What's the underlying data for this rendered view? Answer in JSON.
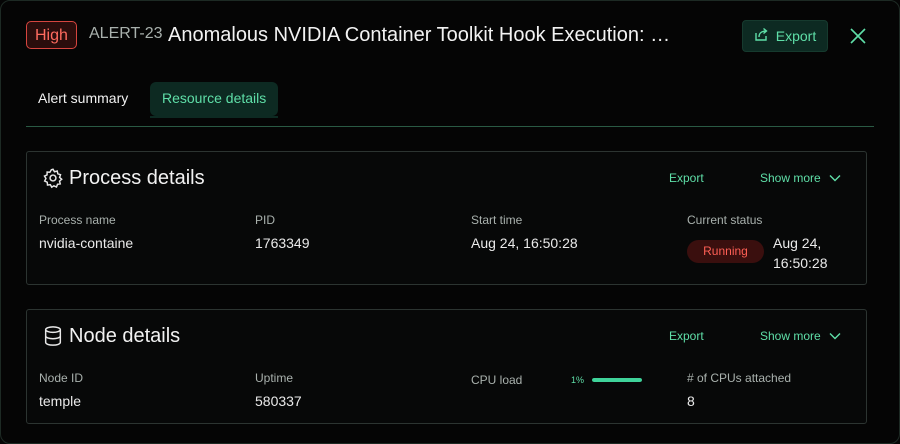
{
  "header": {
    "severity": "High",
    "alert_id": "ALERT-23",
    "title": "Anomalous NVIDIA Container Toolkit Hook Execution: n…",
    "export_label": "Export"
  },
  "tabs": [
    {
      "label": "Alert summary",
      "active": false
    },
    {
      "label": "Resource details",
      "active": true
    }
  ],
  "process": {
    "title": "Process details",
    "export_label": "Export",
    "show_more_label": "Show more",
    "fields": {
      "process_name_label": "Process name",
      "process_name": "nvidia-containe",
      "pid_label": "PID",
      "pid": "1763349",
      "start_time_label": "Start time",
      "start_time": "Aug 24, 16:50:28",
      "status_label": "Current status",
      "status": "Running",
      "status_time": "Aug 24, 16:50:28"
    }
  },
  "node": {
    "title": "Node details",
    "export_label": "Export",
    "show_more_label": "Show more",
    "fields": {
      "node_id_label": "Node ID",
      "node_id": "temple",
      "uptime_label": "Uptime",
      "uptime": "580337",
      "cpu_load_label": "CPU load",
      "cpu_load_pct": "1%",
      "cpu_bar_fill_fraction": 1.0,
      "cpus_label": "# of CPUs attached",
      "cpus": "8"
    }
  },
  "colors": {
    "accent": "#5fdfa8",
    "severity_high": "#ff6b5f",
    "status_running": "#ff5f55"
  },
  "icons": {
    "export": "export-icon",
    "close": "close-icon",
    "process": "gear-icon",
    "node": "database-icon",
    "show_more": "chevron-down-icon"
  }
}
